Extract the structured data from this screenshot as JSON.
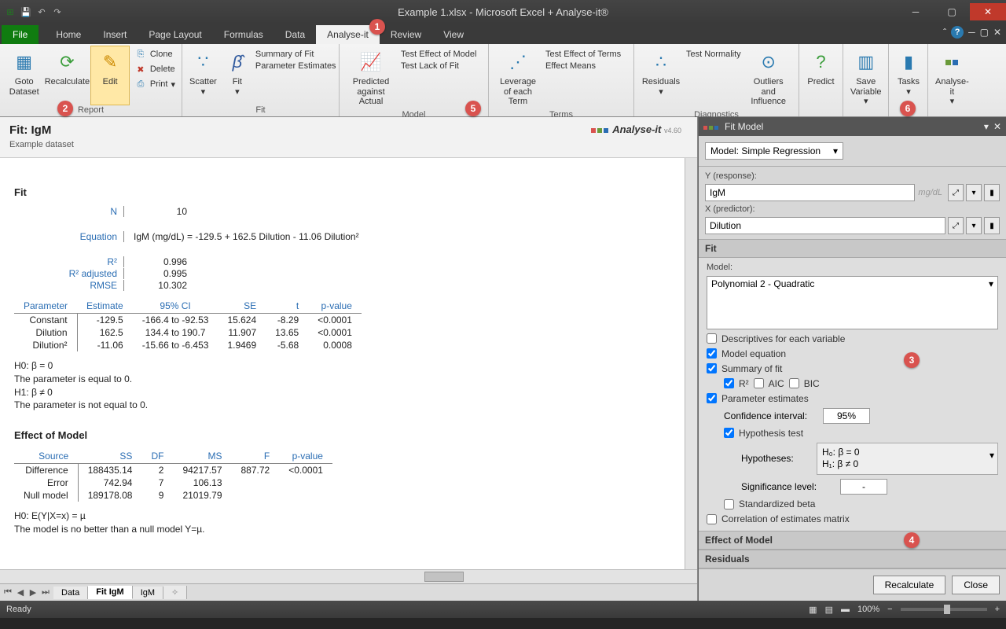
{
  "window": {
    "title": "Example 1.xlsx - Microsoft Excel + Analyse-it®"
  },
  "tabs": [
    "File",
    "Home",
    "Insert",
    "Page Layout",
    "Formulas",
    "Data",
    "Analyse-it",
    "Review",
    "View"
  ],
  "active_tab": "Analyse-it",
  "ribbon": {
    "report": {
      "goto": "Goto Dataset",
      "recalc": "Recalculate",
      "edit": "Edit",
      "clone": "Clone",
      "delete": "Delete",
      "print": "Print",
      "label": "Report"
    },
    "fit": {
      "scatter": "Scatter",
      "fit": "Fit",
      "summary": "Summary of Fit",
      "param": "Parameter Estimates",
      "label": "Fit"
    },
    "model": {
      "pred": "Predicted against Actual",
      "test": "Test Effect of Model",
      "lack": "Test Lack of Fit",
      "label": "Model"
    },
    "terms": {
      "lev": "Leverage of each Term",
      "test": "Test Effect of Terms",
      "means": "Effect Means",
      "label": "Terms"
    },
    "diag": {
      "resid": "Residuals",
      "norm": "Test Normality",
      "out": "Outliers and Influence",
      "label": "Diagnostics"
    },
    "predict": "Predict",
    "save": "Save Variable",
    "tasks": "Tasks",
    "analyse": "Analyse-it"
  },
  "report": {
    "title": "Fit: IgM",
    "subtitle": "Example dataset",
    "brand": "Analyse-it",
    "brand_ver": "v4.60",
    "fit_hdr": "Fit",
    "n_label": "N",
    "n_val": "10",
    "eq_label": "Equation",
    "eq_val": "IgM (mg/dL) = -129.5 + 162.5 Dilution - 11.06 Dilution²",
    "r2": "R²",
    "r2_v": "0.996",
    "r2a": "R² adjusted",
    "r2a_v": "0.995",
    "rmse": "RMSE",
    "rmse_v": "10.302",
    "param_hdr": [
      "Parameter",
      "Estimate",
      "95% CI",
      "SE",
      "t",
      "p-value"
    ],
    "params": [
      {
        "p": "Constant",
        "e": "-129.5",
        "ci": "-166.4 to -92.53",
        "se": "15.624",
        "t": "-8.29",
        "pv": "<0.0001"
      },
      {
        "p": "Dilution",
        "e": "162.5",
        "ci": "134.4 to 190.7",
        "se": "11.907",
        "t": "13.65",
        "pv": "<0.0001"
      },
      {
        "p": "Dilution²",
        "e": "-11.06",
        "ci": "-15.66 to -6.453",
        "se": "1.9469",
        "t": "-5.68",
        "pv": "0.0008"
      }
    ],
    "h0": "H0: β = 0",
    "h0d": "The parameter is equal to 0.",
    "h1": "H1: β ≠ 0",
    "h1d": "The parameter is not equal to 0.",
    "effect_hdr": "Effect of Model",
    "anova_hdr": [
      "Source",
      "SS",
      "DF",
      "MS",
      "F",
      "p-value"
    ],
    "anova": [
      {
        "s": "Difference",
        "ss": "188435.14",
        "df": "2",
        "ms": "94217.57",
        "f": "887.72",
        "p": "<0.0001"
      },
      {
        "s": "Error",
        "ss": "742.94",
        "df": "7",
        "ms": "106.13",
        "f": "",
        "p": ""
      },
      {
        "s": "Null model",
        "ss": "189178.08",
        "df": "9",
        "ms": "21019.79",
        "f": "",
        "p": ""
      }
    ],
    "mh0": "H0: E(Y|X=x) = µ",
    "mh0d": "The model is no better than a null model Y=µ."
  },
  "sheets": [
    "Data",
    "Fit IgM",
    "IgM"
  ],
  "panel": {
    "title": "Fit Model",
    "model_sel": "Model: Simple Regression",
    "y_lab": "Y (response):",
    "y_val": "IgM",
    "y_unit": "mg/dL",
    "x_lab": "X (predictor):",
    "x_val": "Dilution",
    "fit": "Fit",
    "model_lab": "Model:",
    "model_val": "Polynomial 2 - Quadratic",
    "desc": "Descriptives for each variable",
    "meq": "Model equation",
    "sof": "Summary of fit",
    "r2": "R²",
    "aic": "AIC",
    "bic": "BIC",
    "pest": "Parameter estimates",
    "ci_lab": "Confidence interval:",
    "ci_val": "95%",
    "htest": "Hypothesis test",
    "hyp_lab": "Hypotheses:",
    "hyp0": "H₀: β = 0",
    "hyp1": "H₁: β ≠ 0",
    "sig_lab": "Significance level:",
    "sig_val": "-",
    "stdb": "Standardized beta",
    "corr": "Correlation of estimates matrix",
    "eom": "Effect of Model",
    "resid": "Residuals",
    "recalc": "Recalculate",
    "close": "Close"
  },
  "status": {
    "ready": "Ready",
    "zoom": "100%"
  },
  "callouts": {
    "1": "1",
    "2": "2",
    "3": "3",
    "4": "4",
    "5": "5",
    "6": "6"
  }
}
